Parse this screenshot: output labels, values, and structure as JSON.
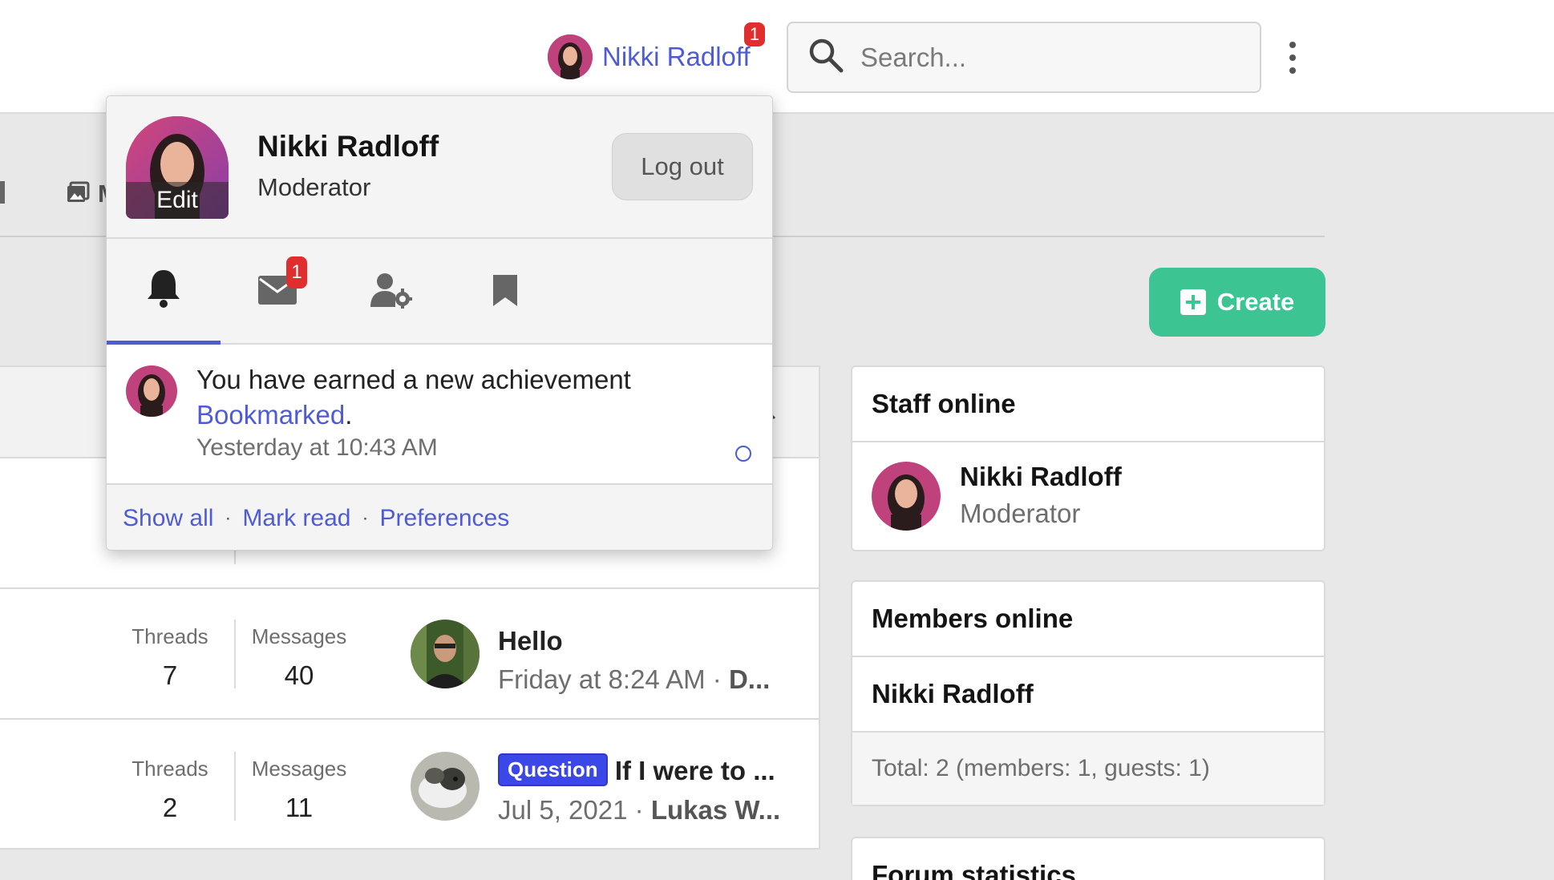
{
  "header": {
    "user_name": "Nikki Radloff",
    "alert_count": "1",
    "search_placeholder": "Search..."
  },
  "nav": {
    "fragment_label": "M"
  },
  "create_label": "Create",
  "forum_rows": [
    {
      "threads_label": "Threads",
      "threads": "7",
      "messages_label": "Messages",
      "messages": "40",
      "latest_title": "Hello",
      "latest_date": "Friday at 8:24 AM",
      "latest_author": "D..."
    },
    {
      "threads_label": "Threads",
      "threads": "2",
      "messages_label": "Messages",
      "messages": "11",
      "prefix": "Question",
      "latest_title": "If I were to ...",
      "latest_date": "Jul 5, 2021",
      "latest_author": "Lukas W..."
    }
  ],
  "sidebar": {
    "staff_title": "Staff online",
    "staff_name": "Nikki Radloff",
    "staff_role": "Moderator",
    "members_title": "Members online",
    "member_name": "Nikki Radloff",
    "total": "Total: 2 (members: 1, guests: 1)",
    "stats_title": "Forum statistics"
  },
  "popup": {
    "name": "Nikki Radloff",
    "role": "Moderator",
    "edit_label": "Edit",
    "logout_label": "Log out",
    "inbox_count": "1",
    "alert_text": "You have earned a new achievement",
    "alert_link": "Bookmarked",
    "alert_period": ".",
    "alert_time": "Yesterday at 10:43 AM",
    "footer": {
      "show_all": "Show all",
      "mark_read": "Mark read",
      "preferences": "Preferences",
      "separator": "·"
    }
  },
  "colors": {
    "accent": "#4f5bd5",
    "create_green": "#3cc593",
    "badge_red": "#e02d2d"
  }
}
